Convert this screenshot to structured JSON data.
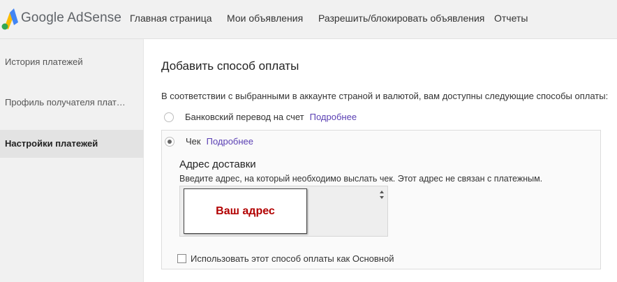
{
  "app": {
    "logo_google": "Google",
    "logo_product": "AdSense"
  },
  "nav": {
    "items": [
      {
        "label": "Главная страница"
      },
      {
        "label": "Мои объявления"
      },
      {
        "label": "Разрешить/блокировать объявления"
      },
      {
        "label": "Отчеты"
      }
    ]
  },
  "sidebar": {
    "items": [
      {
        "label": "История платежей",
        "active": false
      },
      {
        "label": "Профиль получателя платежей",
        "active": false
      },
      {
        "label": "Настройки платежей",
        "active": true
      }
    ]
  },
  "main": {
    "title": "Добавить способ оплаты",
    "description": "В соответствии с выбранными в аккаунте страной и валютой, вам доступны следующие способы оплаты:",
    "options": [
      {
        "label": "Банковский перевод на счет",
        "link": "Подробнее",
        "selected": false
      },
      {
        "label": "Чек",
        "link": "Подробнее",
        "selected": true
      }
    ],
    "check": {
      "address_title": "Адрес доставки",
      "address_hint": "Введите адрес, на который необходимо выслать чек. Этот адрес не связан с платежным.",
      "address_value": "Ваш адрес",
      "primary_checkbox_label": "Использовать этот способ оплаты как Основной",
      "primary_checkbox_checked": false
    }
  },
  "colors": {
    "link": "#5a3fb3",
    "address_text": "#b20000",
    "topbar_bg": "#f1f1f1"
  }
}
